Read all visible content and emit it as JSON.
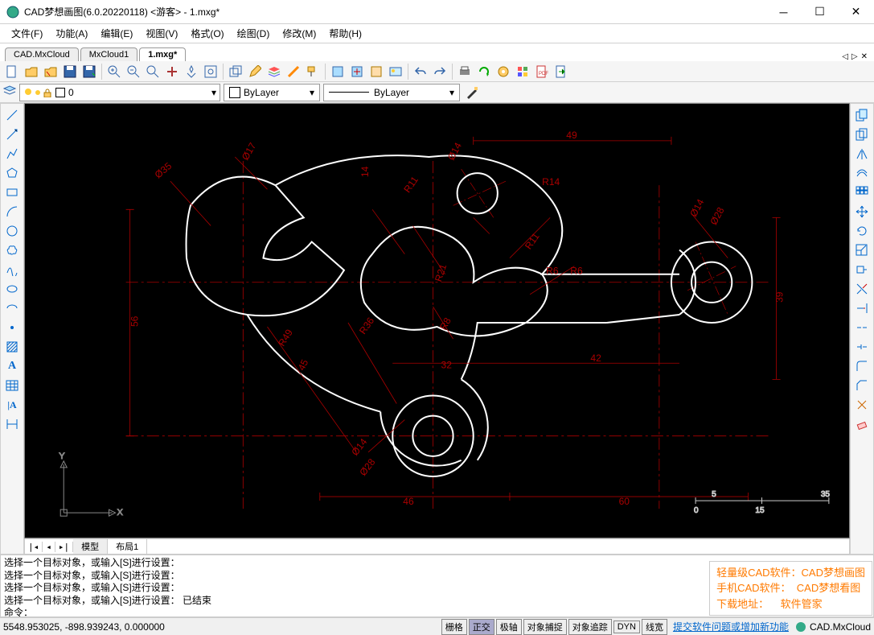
{
  "window": {
    "title": "CAD梦想画图(6.0.20220118) <游客> - 1.mxg*"
  },
  "menu": [
    "文件(F)",
    "功能(A)",
    "编辑(E)",
    "视图(V)",
    "格式(O)",
    "绘图(D)",
    "修改(M)",
    "帮助(H)"
  ],
  "tabs": {
    "items": [
      "CAD.MxCloud",
      "MxCloud1",
      "1.mxg*"
    ],
    "active": 2
  },
  "layerbar": {
    "layer_name": "0",
    "color_label": "ByLayer",
    "linetype_label": "ByLayer"
  },
  "layout_tabs": {
    "items": [
      "模型",
      "布局1"
    ],
    "active": 0
  },
  "command_lines": [
    "选择一个目标对象，或输入[S]进行设置：",
    "选择一个目标对象，或输入[S]进行设置：",
    "选择一个目标对象，或输入[S]进行设置：",
    "选择一个目标对象，或输入[S]进行设置：  已结束"
  ],
  "command_prompt": "命令：",
  "status": {
    "coords": "5548.953025,  -898.939243,  0.000000",
    "toggles": [
      "栅格",
      "正交",
      "极轴",
      "对象捕捉",
      "对象追踪",
      "DYN",
      "线宽"
    ],
    "toggles_active": [
      1
    ],
    "link": "提交软件问题或增加新功能",
    "brand": "CAD.MxCloud"
  },
  "overlay": {
    "l1a": "轻量级CAD软件：",
    "l1b": "CAD梦想画图",
    "l2a": "手机CAD软件：",
    "l2b": "CAD梦想看图",
    "l3a": "下载地址：",
    "l3b": "软件管家"
  },
  "drawing_labels": {
    "d49": "49",
    "d56": "56",
    "d14": "14",
    "d46": "46",
    "d60": "60",
    "d42": "42",
    "d32": "32",
    "d39": "39",
    "d45": "45",
    "r14": "R14",
    "r11a": "R11",
    "r11b": "R11",
    "r6a": "R6",
    "r6b": "R6",
    "r8": "R8",
    "r21": "R21",
    "r36": "R36",
    "r49": "R49",
    "dia35": "Ø35",
    "dia17": "Ø17",
    "dia14a": "Ø14",
    "dia14b": "Ø14",
    "dia14c": "Ø14",
    "dia28a": "Ø28",
    "dia28b": "Ø28",
    "scale_5": "5",
    "scale_35": "35",
    "scale_0": "0",
    "scale_15": "15",
    "axis_x": "X",
    "axis_y": "Y"
  }
}
